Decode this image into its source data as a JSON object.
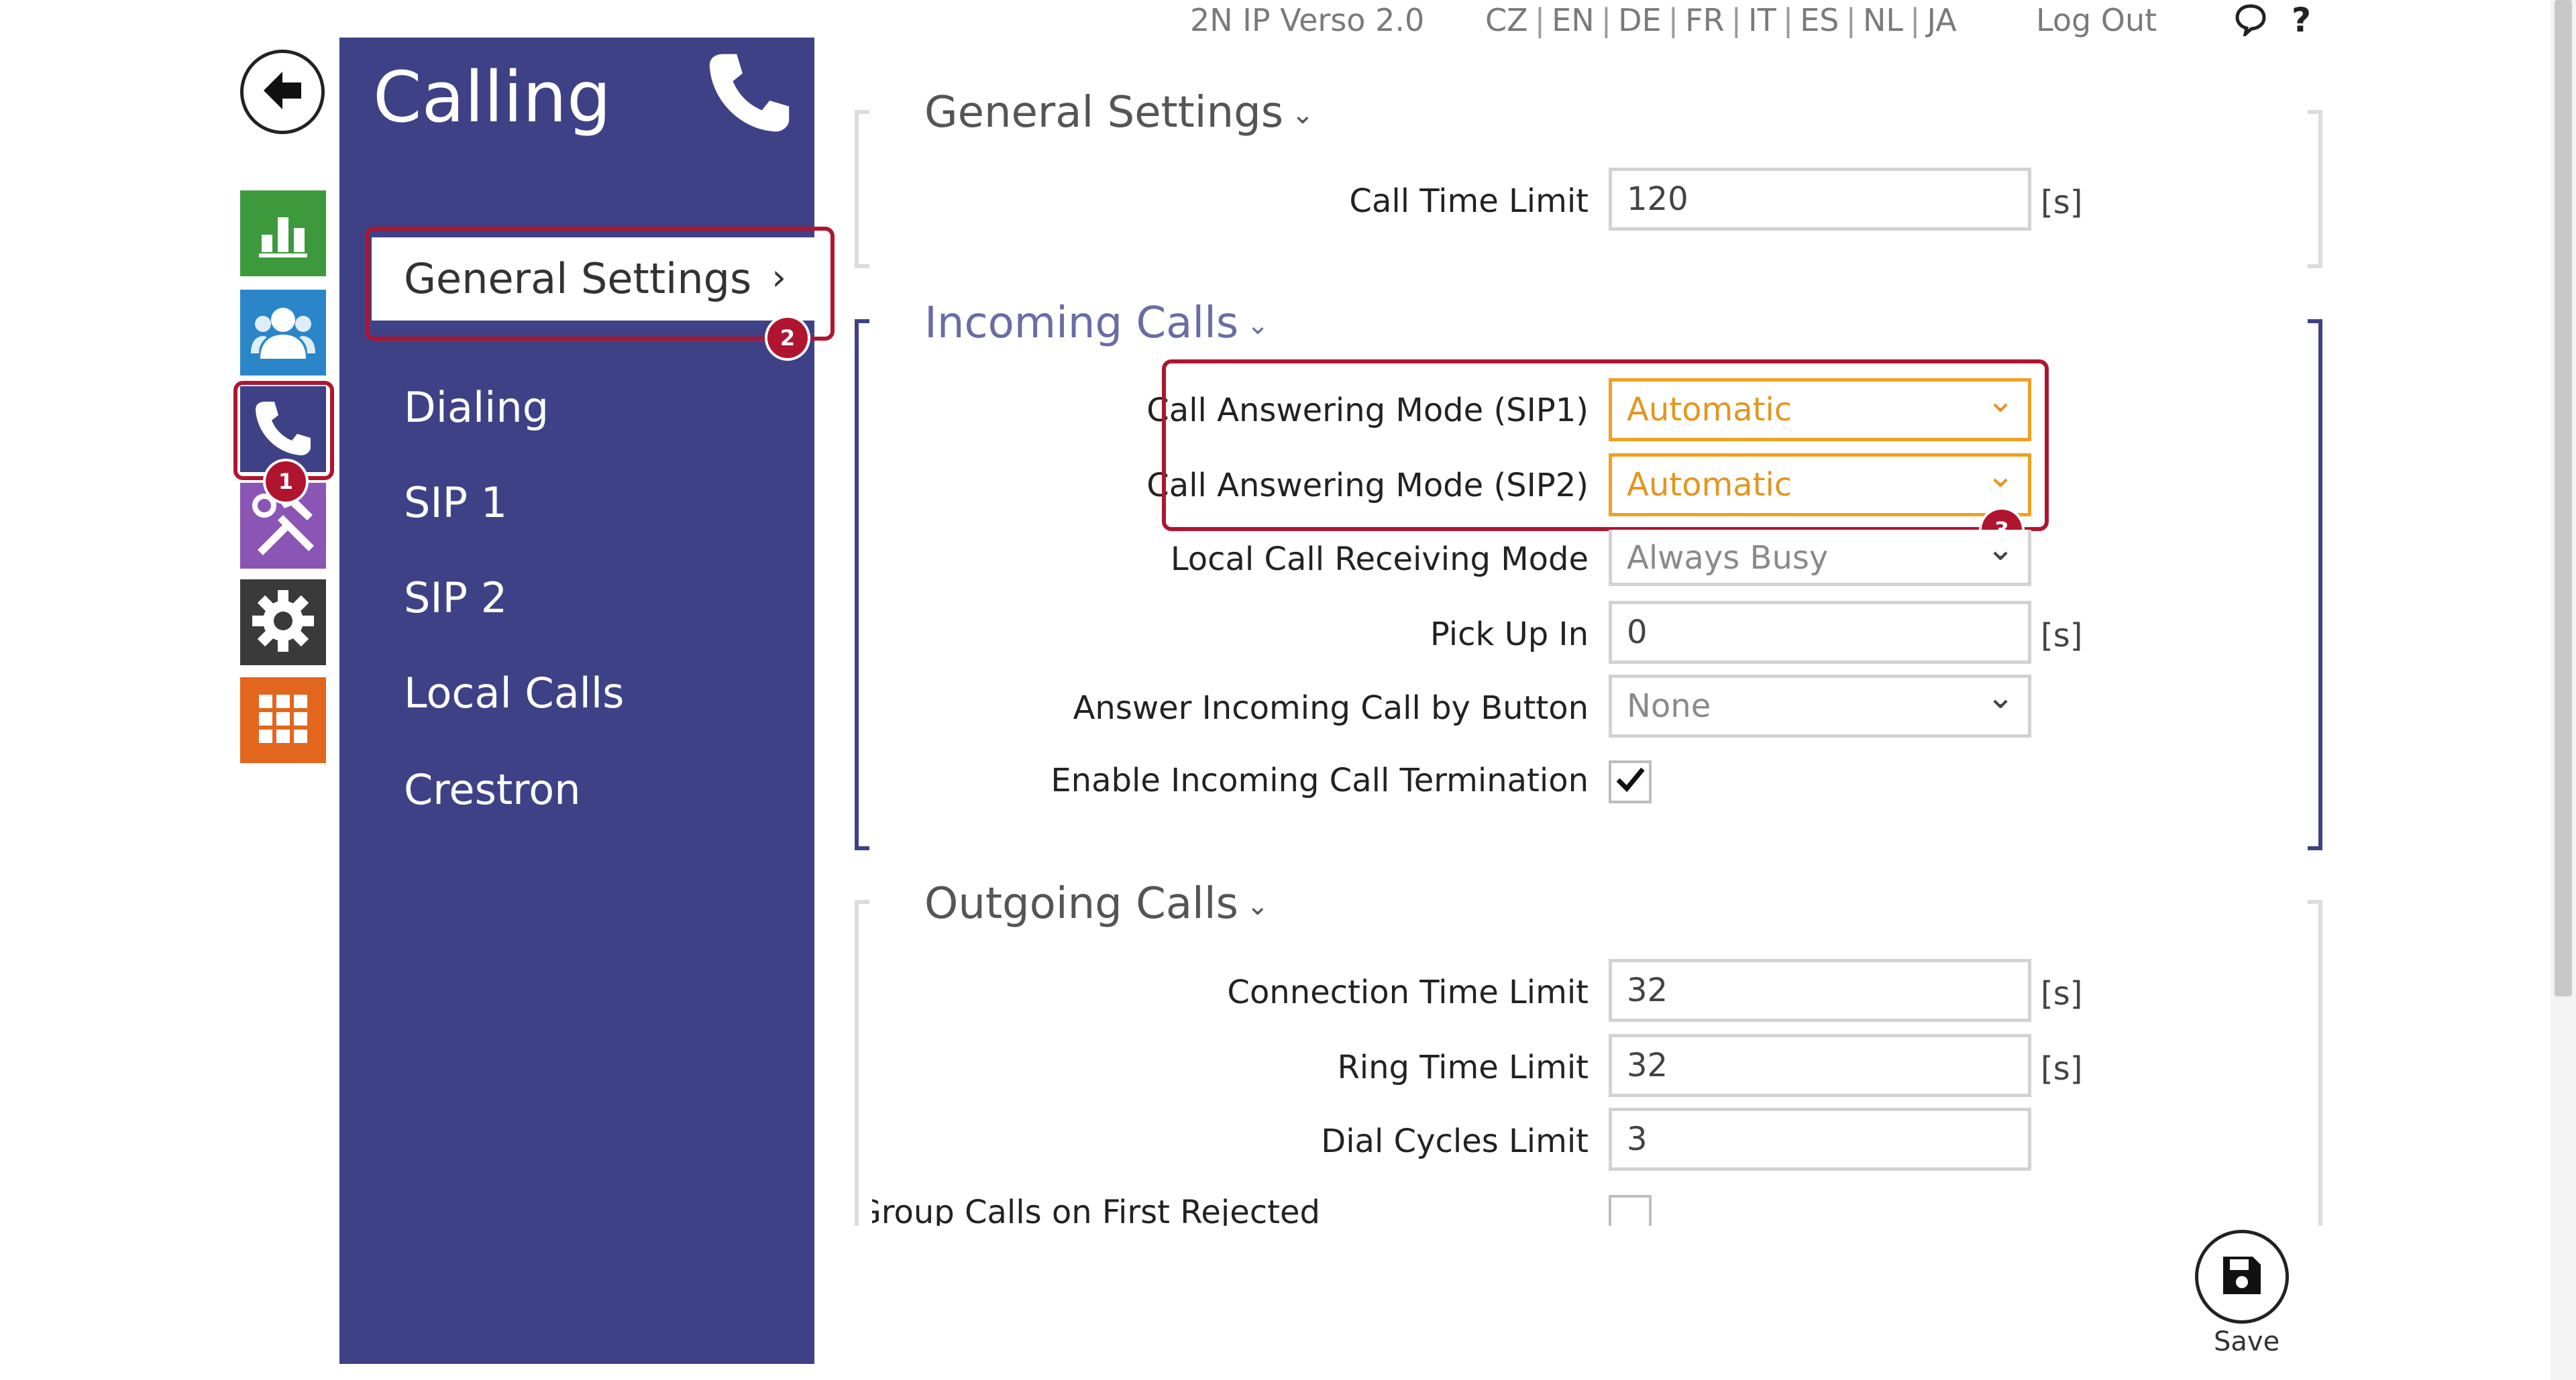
{
  "topbar": {
    "device_name": "2N IP Verso 2.0",
    "languages": [
      "CZ",
      "EN",
      "DE",
      "FR",
      "IT",
      "ES",
      "NL",
      "JA"
    ],
    "logout_label": "Log Out",
    "help_label": "?"
  },
  "rail": {
    "items": [
      {
        "name": "status",
        "color": "#3c9a3c",
        "icon": "bar-chart-icon"
      },
      {
        "name": "directory",
        "color": "#2a86c8",
        "icon": "users-icon"
      },
      {
        "name": "calling",
        "color": "#3f4187",
        "icon": "phone-icon"
      },
      {
        "name": "hardware",
        "color": "#8a55b4",
        "icon": "tools-icon"
      },
      {
        "name": "system",
        "color": "#3a3a3a",
        "icon": "gear-icon"
      },
      {
        "name": "services",
        "color": "#e3661f",
        "icon": "grid-icon"
      }
    ]
  },
  "submenu": {
    "title": "Calling",
    "items": [
      {
        "label": "General Settings",
        "active": true
      },
      {
        "label": "Dialing"
      },
      {
        "label": "SIP 1"
      },
      {
        "label": "SIP 2"
      },
      {
        "label": "Local Calls"
      },
      {
        "label": "Crestron"
      }
    ]
  },
  "badges": {
    "b1": "1",
    "b2": "2",
    "b3": "3"
  },
  "sections": {
    "general": {
      "title": "General Settings",
      "call_time_limit_label": "Call Time Limit",
      "call_time_limit_value": "120",
      "unit": "[s]"
    },
    "incoming": {
      "title": "Incoming Calls",
      "sip1_label": "Call Answering Mode (SIP1)",
      "sip1_value": "Automatic",
      "sip2_label": "Call Answering Mode (SIP2)",
      "sip2_value": "Automatic",
      "local_label": "Local Call Receiving Mode",
      "local_value": "Always Busy",
      "pickup_label": "Pick Up In",
      "pickup_value": "0",
      "pickup_unit": "[s]",
      "button_label": "Answer Incoming Call by Button",
      "button_value": "None",
      "termination_label": "Enable Incoming Call Termination",
      "termination_checked": true
    },
    "outgoing": {
      "title": "Outgoing Calls",
      "connection_label": "Connection Time Limit",
      "connection_value": "32",
      "connection_unit": "[s]",
      "ring_label": "Ring Time Limit",
      "ring_value": "32",
      "ring_unit": "[s]",
      "dial_label": "Dial Cycles Limit",
      "dial_value": "3",
      "terminate_label": "Terminate Group Calls on First Rejected"
    }
  },
  "save_label": "Save",
  "colors": {
    "accent": "#3f4187",
    "highlight": "#b0152f",
    "warning": "#f0a020"
  }
}
